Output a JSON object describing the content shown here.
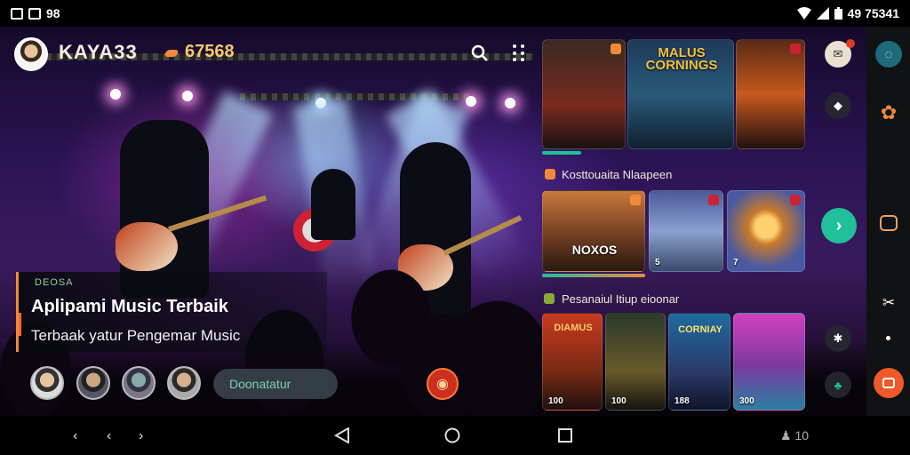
{
  "status_bar": {
    "left_text": "98",
    "right_text": "49 75341"
  },
  "header": {
    "username": "KAYA33",
    "coins": "67568"
  },
  "promo": {
    "tag": "DEOSA",
    "title": "Aplipami Music Terbaik",
    "subtitle": "Terbaak yatur Pengemar Music",
    "follow_button": "Doonatatur"
  },
  "tiles_row1": [
    {
      "caption": ""
    },
    {
      "caption": "MALUS CORNINGS"
    },
    {
      "caption": ""
    }
  ],
  "section2": {
    "title": "Kosttouaita Nlaapeen",
    "tiles": [
      {
        "caption": "NOXOS",
        "sub": ""
      },
      {
        "caption": "",
        "sub": "5"
      },
      {
        "caption": "",
        "sub": "7"
      }
    ]
  },
  "section3": {
    "title": "Pesanaiul Itiup eioonar",
    "tiles": [
      {
        "banner": "DIAMUS",
        "number": "100"
      },
      {
        "banner": "",
        "number": "100"
      },
      {
        "banner": "CORNIAY",
        "number": "188"
      },
      {
        "banner": "",
        "number": "300"
      }
    ]
  },
  "nav": {
    "right_label": "10"
  },
  "colors": {
    "accent_orange": "#f08a3a",
    "accent_teal": "#20c09a",
    "coin_gold": "#f7c86a",
    "sidebar_bg": "#101214"
  }
}
